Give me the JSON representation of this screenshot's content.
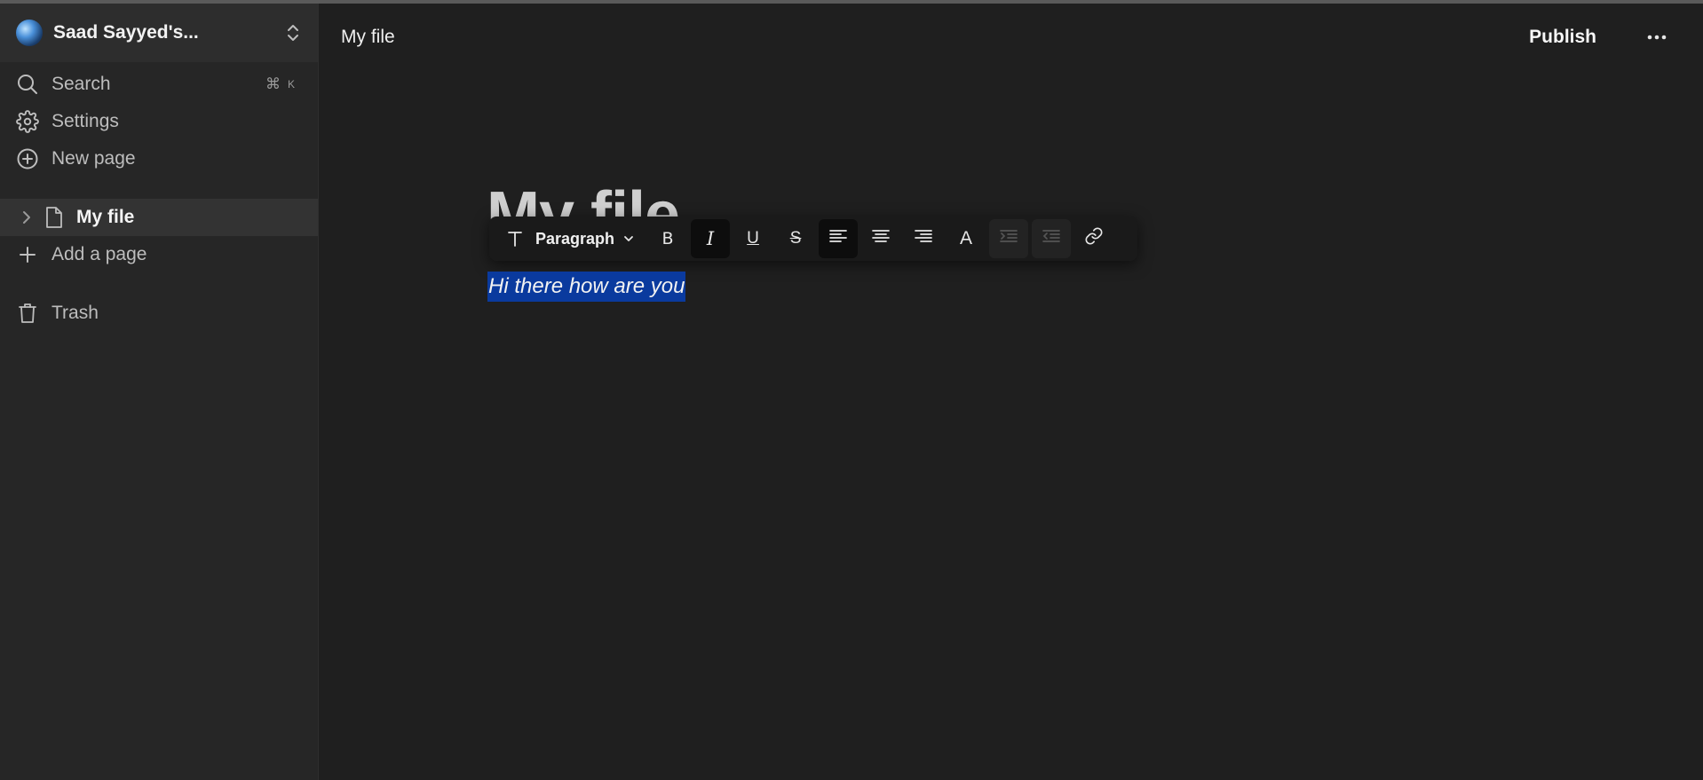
{
  "sidebar": {
    "workspace_name": "Saad Sayyed's...",
    "nav": {
      "search_label": "Search",
      "search_shortcut_key": "K",
      "settings_label": "Settings",
      "new_page_label": "New page"
    },
    "pages": [
      {
        "label": "My file"
      }
    ],
    "add_page_label": "Add a page",
    "trash_label": "Trash"
  },
  "header": {
    "title": "My file",
    "publish_label": "Publish"
  },
  "editor": {
    "document_title": "My file",
    "toolbar": {
      "block_type": "Paragraph",
      "buttons": {
        "bold": "B",
        "italic": "I",
        "underline": "U",
        "strikethrough": "S",
        "font_color": "A"
      },
      "active": [
        "italic",
        "align-left"
      ],
      "disabled": [
        "indent",
        "outdent"
      ]
    },
    "body_text": "Hi there how are you"
  },
  "colors": {
    "background": "#1f1f1f",
    "sidebar": "#262626",
    "selection": "#0a3a9e"
  }
}
